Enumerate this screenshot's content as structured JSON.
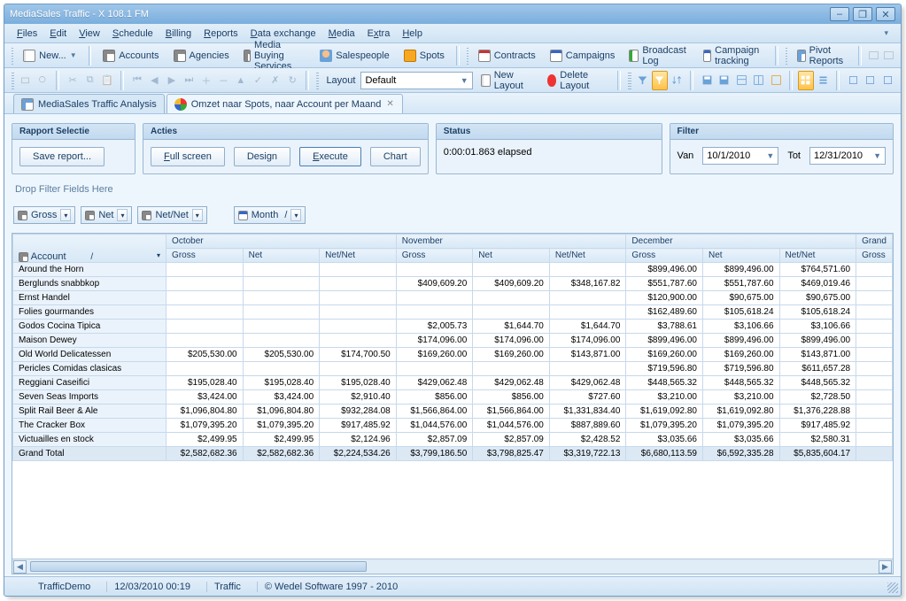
{
  "window": {
    "title": "MediaSales Traffic - X 108.1 FM"
  },
  "menu": [
    "Files",
    "Edit",
    "View",
    "Schedule",
    "Billing",
    "Reports",
    "Data exchange",
    "Media",
    "Extra",
    "Help"
  ],
  "toolbar1": {
    "new": "New...",
    "accounts": "Accounts",
    "agencies": "Agencies",
    "media_buying": "Media Buying Services",
    "salespeople": "Salespeople",
    "spots": "Spots",
    "contracts": "Contracts",
    "campaigns": "Campaigns",
    "broadcast_log": "Broadcast Log",
    "campaign_tracking": "Campaign tracking",
    "pivot_reports": "Pivot Reports"
  },
  "toolbar2": {
    "layout_label": "Layout",
    "layout_value": "Default",
    "new_layout": "New Layout",
    "delete_layout": "Delete Layout"
  },
  "tabs": [
    {
      "label": "MediaSales Traffic Analysis",
      "icon": "doc",
      "active": false,
      "closable": false
    },
    {
      "label": "Omzet naar Spots, naar Account per Maand",
      "icon": "dot4",
      "active": true,
      "closable": true
    }
  ],
  "panels": {
    "rapport": {
      "title": "Rapport Selectie",
      "save": "Save report..."
    },
    "acties": {
      "title": "Acties",
      "fullscreen": "Full screen",
      "design": "Design",
      "execute": "Execute",
      "chart": "Chart"
    },
    "status": {
      "title": "Status",
      "text": "0:00:01.863 elapsed"
    },
    "filter": {
      "title": "Filter",
      "van_label": "Van",
      "van": "10/1/2010",
      "tot_label": "Tot",
      "tot": "12/31/2010"
    }
  },
  "dropzone": "Drop Filter Fields Here",
  "data_fields": [
    "Gross",
    "Net",
    "Net/Net"
  ],
  "col_field": "Month",
  "row_field": "Account",
  "months": [
    "October",
    "November",
    "December"
  ],
  "subcols": [
    "Gross",
    "Net",
    "Net/Net"
  ],
  "extra_col": "Grand",
  "rows": [
    {
      "name": "Around the Horn",
      "oct": [
        "",
        "",
        ""
      ],
      "nov": [
        "",
        "",
        ""
      ],
      "dec": [
        "$899,496.00",
        "$899,496.00",
        "$764,571.60"
      ]
    },
    {
      "name": "Berglunds snabbkop",
      "oct": [
        "",
        "",
        ""
      ],
      "nov": [
        "$409,609.20",
        "$409,609.20",
        "$348,167.82"
      ],
      "dec": [
        "$551,787.60",
        "$551,787.60",
        "$469,019.46"
      ]
    },
    {
      "name": "Ernst Handel",
      "oct": [
        "",
        "",
        ""
      ],
      "nov": [
        "",
        "",
        ""
      ],
      "dec": [
        "$120,900.00",
        "$90,675.00",
        "$90,675.00"
      ]
    },
    {
      "name": "Folies gourmandes",
      "oct": [
        "",
        "",
        ""
      ],
      "nov": [
        "",
        "",
        ""
      ],
      "dec": [
        "$162,489.60",
        "$105,618.24",
        "$105,618.24"
      ]
    },
    {
      "name": "Godos Cocina Tipica",
      "oct": [
        "",
        "",
        ""
      ],
      "nov": [
        "$2,005.73",
        "$1,644.70",
        "$1,644.70"
      ],
      "dec": [
        "$3,788.61",
        "$3,106.66",
        "$3,106.66"
      ]
    },
    {
      "name": "Maison Dewey",
      "oct": [
        "",
        "",
        ""
      ],
      "nov": [
        "$174,096.00",
        "$174,096.00",
        "$174,096.00"
      ],
      "dec": [
        "$899,496.00",
        "$899,496.00",
        "$899,496.00"
      ]
    },
    {
      "name": "Old World Delicatessen",
      "oct": [
        "$205,530.00",
        "$205,530.00",
        "$174,700.50"
      ],
      "nov": [
        "$169,260.00",
        "$169,260.00",
        "$143,871.00"
      ],
      "dec": [
        "$169,260.00",
        "$169,260.00",
        "$143,871.00"
      ]
    },
    {
      "name": "Pericles Comidas clasicas",
      "oct": [
        "",
        "",
        ""
      ],
      "nov": [
        "",
        "",
        ""
      ],
      "dec": [
        "$719,596.80",
        "$719,596.80",
        "$611,657.28"
      ]
    },
    {
      "name": "Reggiani Caseifici",
      "oct": [
        "$195,028.40",
        "$195,028.40",
        "$195,028.40"
      ],
      "nov": [
        "$429,062.48",
        "$429,062.48",
        "$429,062.48"
      ],
      "dec": [
        "$448,565.32",
        "$448,565.32",
        "$448,565.32"
      ]
    },
    {
      "name": "Seven Seas Imports",
      "oct": [
        "$3,424.00",
        "$3,424.00",
        "$2,910.40"
      ],
      "nov": [
        "$856.00",
        "$856.00",
        "$727.60"
      ],
      "dec": [
        "$3,210.00",
        "$3,210.00",
        "$2,728.50"
      ]
    },
    {
      "name": "Split Rail Beer & Ale",
      "oct": [
        "$1,096,804.80",
        "$1,096,804.80",
        "$932,284.08"
      ],
      "nov": [
        "$1,566,864.00",
        "$1,566,864.00",
        "$1,331,834.40"
      ],
      "dec": [
        "$1,619,092.80",
        "$1,619,092.80",
        "$1,376,228.88"
      ]
    },
    {
      "name": "The Cracker Box",
      "oct": [
        "$1,079,395.20",
        "$1,079,395.20",
        "$917,485.92"
      ],
      "nov": [
        "$1,044,576.00",
        "$1,044,576.00",
        "$887,889.60"
      ],
      "dec": [
        "$1,079,395.20",
        "$1,079,395.20",
        "$917,485.92"
      ]
    },
    {
      "name": "Victuailles en stock",
      "oct": [
        "$2,499.95",
        "$2,499.95",
        "$2,124.96"
      ],
      "nov": [
        "$2,857.09",
        "$2,857.09",
        "$2,428.52"
      ],
      "dec": [
        "$3,035.66",
        "$3,035.66",
        "$2,580.31"
      ]
    }
  ],
  "total": {
    "name": "Grand Total",
    "oct": [
      "$2,582,682.36",
      "$2,582,682.36",
      "$2,224,534.26"
    ],
    "nov": [
      "$3,799,186.50",
      "$3,798,825.47",
      "$3,319,722.13"
    ],
    "dec": [
      "$6,680,113.59",
      "$6,592,335.28",
      "$5,835,604.17"
    ]
  },
  "status": {
    "db": "TrafficDemo",
    "date": "12/03/2010 00:19",
    "mode": "Traffic",
    "copyright": "© Wedel Software 1997 - 2010"
  }
}
